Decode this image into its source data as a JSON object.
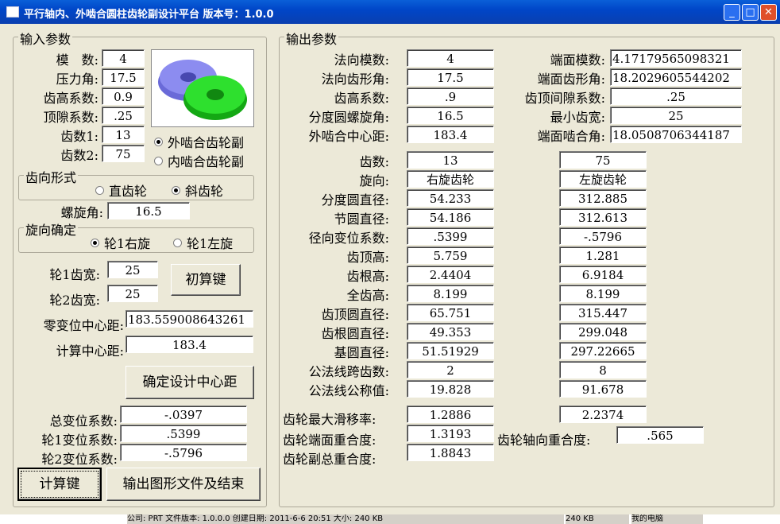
{
  "window": {
    "title": "平行轴内、外啮合圆柱齿轮副设计平台 版本号：1.0.0",
    "controls": {
      "min": "_",
      "max": "□",
      "close": "✕"
    }
  },
  "input": {
    "legend": "输入参数",
    "fields": [
      {
        "label": "模　数:",
        "value": "4"
      },
      {
        "label": "压力角:",
        "value": "17.5"
      },
      {
        "label": "齿高系数:",
        "value": "0.9"
      },
      {
        "label": "顶隙系数:",
        "value": ".25"
      },
      {
        "label": "齿数1:",
        "value": "13"
      },
      {
        "label": "齿数2:",
        "value": "75"
      }
    ],
    "mesh_options": [
      {
        "label": "外啮合齿轮副",
        "checked": true
      },
      {
        "label": "内啮合齿轮副",
        "checked": false
      }
    ],
    "tooth_form": {
      "legend": "齿向形式",
      "options": [
        {
          "label": "直齿轮",
          "checked": false
        },
        {
          "label": "斜齿轮",
          "checked": true
        }
      ]
    },
    "helix": {
      "label": "螺旋角:",
      "value": "16.5"
    },
    "hand": {
      "legend": "旋向确定",
      "options": [
        {
          "label": "轮1右旋",
          "checked": true
        },
        {
          "label": "轮1左旋",
          "checked": false
        }
      ]
    },
    "width1": {
      "label": "轮1齿宽:",
      "value": "25"
    },
    "width2": {
      "label": "轮2齿宽:",
      "value": "25"
    },
    "init_button": "初算键",
    "zero_center": {
      "label": "零变位中心距:",
      "value": "183.559008643261"
    },
    "calc_center": {
      "label": "计算中心距:",
      "value": "183.4"
    },
    "confirm_button": "确定设计中心距",
    "total_shift": {
      "label": "总变位系数:",
      "value": "-.0397"
    },
    "shift1": {
      "label": "轮1变位系数:",
      "value": ".5399"
    },
    "shift2": {
      "label": "轮2变位系数:",
      "value": "-.5796"
    },
    "calc_button": "计算键",
    "export_button": "输出图形文件及结束"
  },
  "output": {
    "legend": "输出参数",
    "top_left": [
      {
        "label": "法向模数:",
        "value": "4"
      },
      {
        "label": "法向齿形角:",
        "value": "17.5"
      },
      {
        "label": "齿高系数:",
        "value": ".9"
      },
      {
        "label": "分度圆螺旋角:",
        "value": "16.5"
      },
      {
        "label": "外啮合中心距:",
        "value": "183.4"
      }
    ],
    "top_right": [
      {
        "label": "端面模数:",
        "value": "4.17179565098321"
      },
      {
        "label": "端面齿形角:",
        "value": "18.2029605544202"
      },
      {
        "label": "齿顶间隙系数:",
        "value": ".25"
      },
      {
        "label": "最小齿宽:",
        "value": "25"
      },
      {
        "label": "端面啮合角:",
        "value": "18.0508706344187"
      }
    ],
    "table": [
      {
        "label": "齿数:",
        "g1": "13",
        "g2": "75"
      },
      {
        "label": "旋向:",
        "g1": "右旋齿轮",
        "g2": "左旋齿轮"
      },
      {
        "label": "分度圆直径:",
        "g1": "54.233",
        "g2": "312.885"
      },
      {
        "label": "节圆直径:",
        "g1": "54.186",
        "g2": "312.613"
      },
      {
        "label": "径向变位系数:",
        "g1": ".5399",
        "g2": "-.5796"
      },
      {
        "label": "齿顶高:",
        "g1": "5.759",
        "g2": "1.281"
      },
      {
        "label": "齿根高:",
        "g1": "2.4404",
        "g2": "6.9184"
      },
      {
        "label": "全齿高:",
        "g1": "8.199",
        "g2": "8.199"
      },
      {
        "label": "齿顶圆直径:",
        "g1": "65.751",
        "g2": "315.447"
      },
      {
        "label": "齿根圆直径:",
        "g1": "49.353",
        "g2": "299.048"
      },
      {
        "label": "基圆直径:",
        "g1": "51.51929",
        "g2": "297.22665"
      },
      {
        "label": "公法线跨齿数:",
        "g1": "2",
        "g2": "8"
      },
      {
        "label": "公法线公称值:",
        "g1": "19.828",
        "g2": "91.678"
      }
    ],
    "max_slip": {
      "label": "齿轮最大滑移率:",
      "g1": "1.2886",
      "g2": "2.2374"
    },
    "transverse_contact": {
      "label": "齿轮端面重合度:",
      "value": "1.3193"
    },
    "axial_contact": {
      "label": "齿轮轴向重合度:",
      "value": ".565"
    },
    "total_contact": {
      "label": "齿轮副总重合度:",
      "value": "1.8843"
    }
  },
  "taskbar": {
    "info": "公司: PRT 文件版本: 1.0.0.0 创建日期: 2011-6-6 20:51 大小: 240 KB",
    "size": "240 KB",
    "computer": "我的电脑"
  },
  "gear_colors": {
    "gear1": "#7a7ae8",
    "gear2": "#22cc22"
  }
}
